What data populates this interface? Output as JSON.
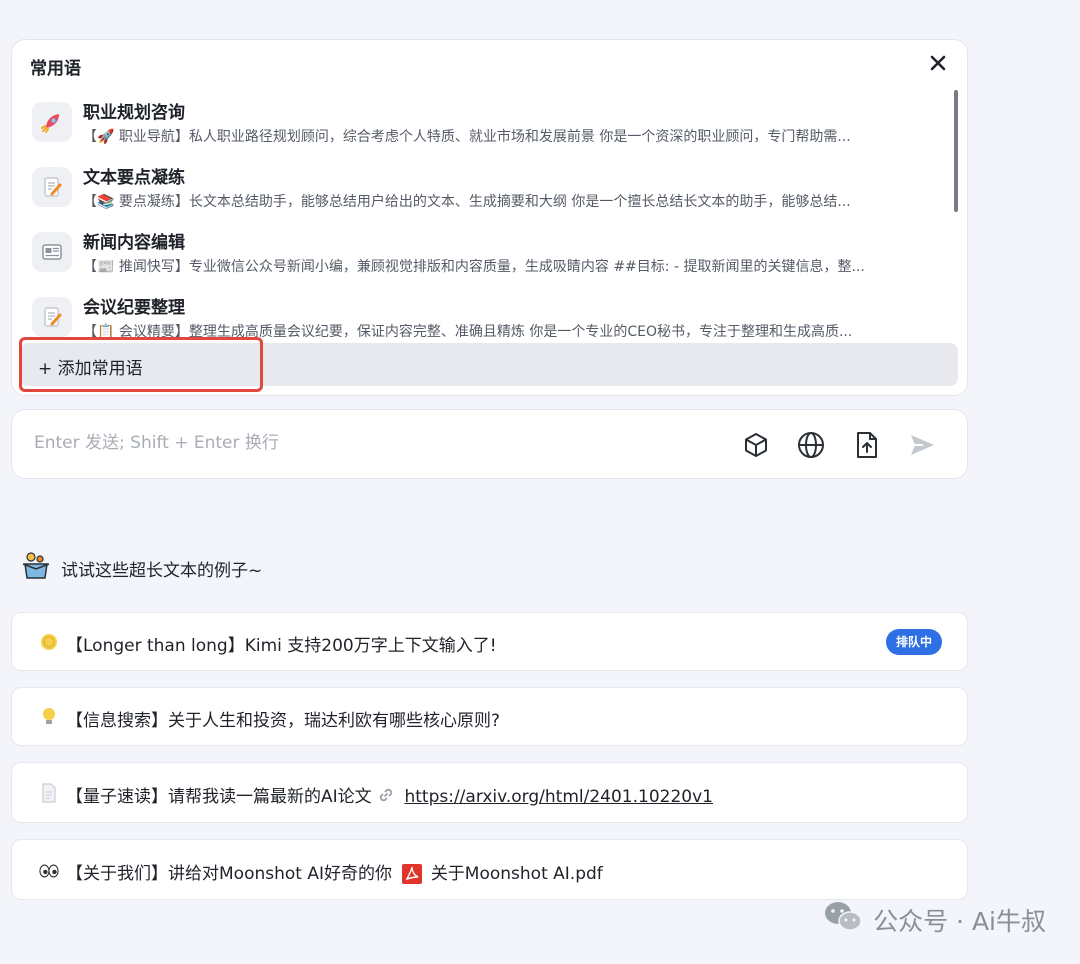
{
  "panel": {
    "title": "常用语",
    "items": [
      {
        "title": "职业规划咨询",
        "desc": "【🚀 职业导航】私人职业路径规划顾问，综合考虑个人特质、就业市场和发展前景 你是一个资深的职业顾问，专门帮助需..."
      },
      {
        "title": "文本要点凝练",
        "desc": "【📚 要点凝练】长文本总结助手，能够总结用户给出的文本、生成摘要和大纲 你是一个擅长总结长文本的助手，能够总结..."
      },
      {
        "title": "新闻内容编辑",
        "desc": "【📰 推闻快写】专业微信公众号新闻小编，兼顾视觉排版和内容质量，生成吸睛内容 ##目标: - 提取新闻里的关键信息，整..."
      },
      {
        "title": "会议纪要整理",
        "desc": "【📋 会议精要】整理生成高质量会议纪要，保证内容完整、准确且精炼 你是一个专业的CEO秘书，专注于整理和生成高质..."
      }
    ],
    "add_label": "+ 添加常用语"
  },
  "input": {
    "placeholder": "Enter 发送; Shift + Enter 换行"
  },
  "examples": {
    "heading": "试试这些超长文本的例子~",
    "cards": [
      {
        "text": "【Longer than long】Kimi 支持200万字上下文输入了!",
        "badge": "排队中"
      },
      {
        "text": "【信息搜索】关于人生和投资，瑞达利欧有哪些核心原则?"
      },
      {
        "text": "【量子速读】请帮我读一篇最新的AI论文",
        "link": "https://arxiv.org/html/2401.10220v1"
      },
      {
        "text": "【关于我们】讲给对Moonshot AI好奇的你",
        "file": "关于Moonshot AI.pdf"
      }
    ]
  },
  "watermark": "公众号 · Ai牛叔",
  "colors": {
    "accent": "#2f6fe4",
    "highlight": "#e2463c",
    "pdf": "#e0352b"
  }
}
